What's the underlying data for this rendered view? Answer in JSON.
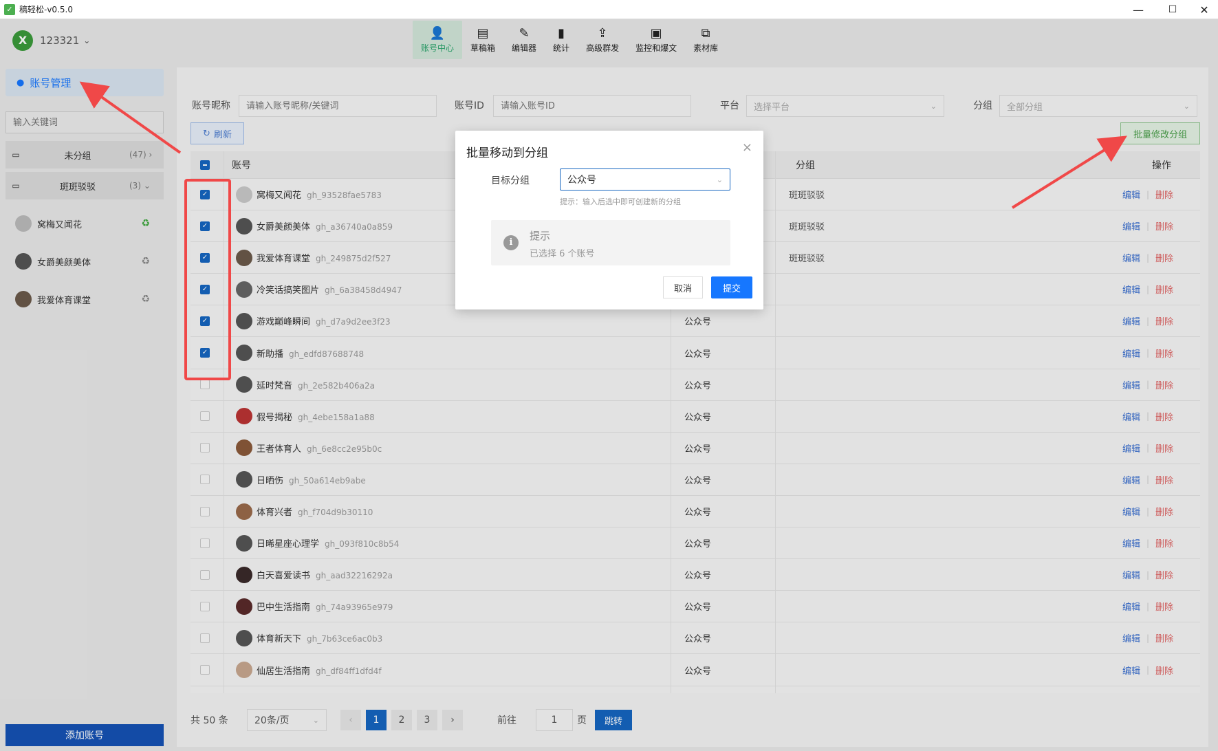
{
  "window": {
    "title": "稿轻松-v0.5.0",
    "min": "—",
    "max": "☐",
    "close": "✕"
  },
  "user": {
    "avatar": "X",
    "name": "123321",
    "chev": "⌄"
  },
  "topnav": [
    {
      "label": "账号中心",
      "icon": "👤"
    },
    {
      "label": "草稿箱",
      "icon": "▤"
    },
    {
      "label": "编辑器",
      "icon": "✎"
    },
    {
      "label": "统计",
      "icon": "▮"
    },
    {
      "label": "高级群发",
      "icon": "⇪"
    },
    {
      "label": "监控和爆文",
      "icon": "▣"
    },
    {
      "label": "素材库",
      "icon": "⧉"
    }
  ],
  "sidebar": {
    "account_mgmt": "账号管理",
    "search_placeholder": "输入关键词",
    "groups": [
      {
        "name": "未分组",
        "count": "(47)",
        "chev": "›"
      },
      {
        "name": "斑斑驳驳",
        "count": "(3)",
        "chev": "⌄"
      }
    ],
    "accounts": [
      "窝梅又闻花",
      "女爵美颜美体",
      "我爱体育课堂"
    ],
    "add_button": "添加账号"
  },
  "filters": {
    "nickname_label": "账号昵称",
    "nickname_placeholder": "请输入账号昵称/关键词",
    "id_label": "账号ID",
    "id_placeholder": "请输入账号ID",
    "platform_label": "平台",
    "platform_placeholder": "选择平台",
    "group_label": "分组",
    "group_value": "全部分组"
  },
  "actions": {
    "refresh": "刷新",
    "batch_modify": "批量修改分组"
  },
  "table": {
    "headers": {
      "account": "账号",
      "group": "分组",
      "ops": "操作"
    },
    "edit_label": "编辑",
    "delete_label": "删除",
    "rows": [
      {
        "name": "窝梅又闻花",
        "id": "gh_93528fae5783",
        "platform": "",
        "group": "斑斑驳驳",
        "checked": true
      },
      {
        "name": "女爵美颜美体",
        "id": "gh_a36740a0a859",
        "platform": "",
        "group": "斑斑驳驳",
        "checked": true
      },
      {
        "name": "我爱体育课堂",
        "id": "gh_249875d2f527",
        "platform": "",
        "group": "斑斑驳驳",
        "checked": true
      },
      {
        "name": "冷笑话搞笑图片",
        "id": "gh_6a38458d4947",
        "platform": "",
        "group": "",
        "checked": true
      },
      {
        "name": "游戏巅峰瞬间",
        "id": "gh_d7a9d2ee3f23",
        "platform": "公众号",
        "group": "",
        "checked": true
      },
      {
        "name": "新助播",
        "id": "gh_edfd87688748",
        "platform": "公众号",
        "group": "",
        "checked": true
      },
      {
        "name": "延时梵音",
        "id": "gh_2e582b406a2a",
        "platform": "公众号",
        "group": "",
        "checked": false
      },
      {
        "name": "假号揭秘",
        "id": "gh_4ebe158a1a88",
        "platform": "公众号",
        "group": "",
        "checked": false
      },
      {
        "name": "王者体育人",
        "id": "gh_6e8cc2e95b0c",
        "platform": "公众号",
        "group": "",
        "checked": false
      },
      {
        "name": "日晒伤",
        "id": "gh_50a614eb9abe",
        "platform": "公众号",
        "group": "",
        "checked": false
      },
      {
        "name": "体育兴者",
        "id": "gh_f704d9b30110",
        "platform": "公众号",
        "group": "",
        "checked": false
      },
      {
        "name": "日晞星座心理学",
        "id": "gh_093f810c8b54",
        "platform": "公众号",
        "group": "",
        "checked": false
      },
      {
        "name": "白天喜爱读书",
        "id": "gh_aad32216292a",
        "platform": "公众号",
        "group": "",
        "checked": false
      },
      {
        "name": "巴中生活指南",
        "id": "gh_74a93965e979",
        "platform": "公众号",
        "group": "",
        "checked": false
      },
      {
        "name": "体育新天下",
        "id": "gh_7b63ce6ac0b3",
        "platform": "公众号",
        "group": "",
        "checked": false
      },
      {
        "name": "仙居生活指南",
        "id": "gh_df84ff1dfd4f",
        "platform": "公众号",
        "group": "",
        "checked": false
      }
    ]
  },
  "pagination": {
    "total": "共 50 条",
    "page_size": "20条/页",
    "prev": "‹",
    "next": "›",
    "pages": [
      "1",
      "2",
      "3"
    ],
    "goto": "前往",
    "goto_value": "1",
    "page_unit": "页",
    "jump": "跳转"
  },
  "dialog": {
    "title": "批量移动到分组",
    "close": "×",
    "target_label": "目标分组",
    "target_value": "公众号",
    "hint": "提示：输入后选中即可创建新的分组",
    "info_icon": "i",
    "info_title": "提示",
    "info_text": "已选择 6 个账号",
    "cancel": "取消",
    "submit": "提交"
  },
  "colors": {
    "accent": "#1565c0",
    "annotation": "#f04848",
    "active_nav": "#27a36a"
  }
}
